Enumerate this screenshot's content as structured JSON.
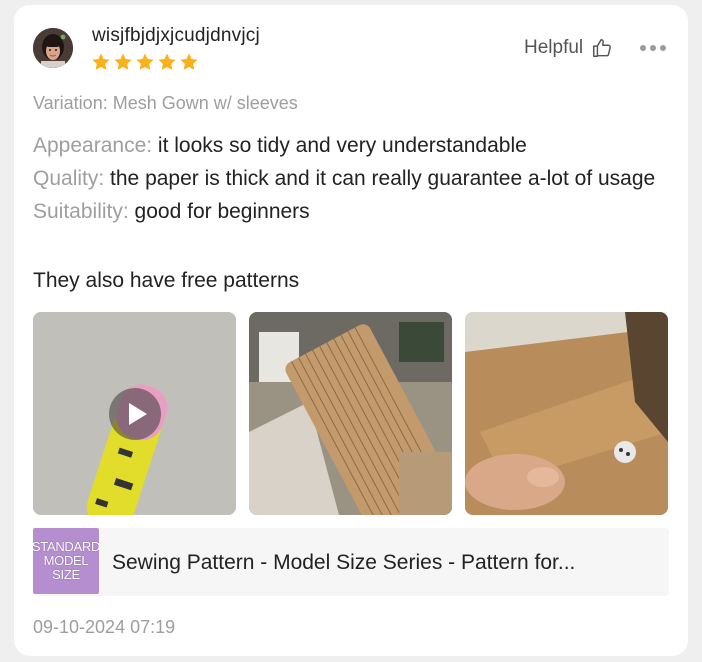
{
  "reviewer": {
    "username": "wisjfbjdjxjcudjdnvjcj",
    "rating": 5,
    "avatar_icon": "user-avatar-photo"
  },
  "actions": {
    "helpful_label": "Helpful",
    "helpful_icon": "thumbs-up-icon",
    "more_icon": "more-dots-icon"
  },
  "variation": "Variation: Mesh Gown w/ sleeves",
  "review": {
    "appearance_key": "Appearance:",
    "appearance_value": " it looks so tidy and very understandable",
    "quality_key": "Quality:",
    "quality_value": " the paper is thick and it can really guarantee a-lot of usage",
    "suitability_key": "Suitability:",
    "suitability_value": " good for beginners",
    "extra_text": "They also have free patterns"
  },
  "media": [
    {
      "kind": "video",
      "icon": "play-icon"
    },
    {
      "kind": "image"
    },
    {
      "kind": "image"
    }
  ],
  "product": {
    "thumb_lines": [
      "STANDARD",
      "MODEL",
      "SIZE"
    ],
    "title": "Sewing Pattern - Model Size Series - Pattern for..."
  },
  "timestamp": "09-10-2024 07:19",
  "colors": {
    "star": "#f9b21b",
    "muted": "#9e9e9e",
    "text": "#222222",
    "thumb_bg": "#b58ed0"
  }
}
